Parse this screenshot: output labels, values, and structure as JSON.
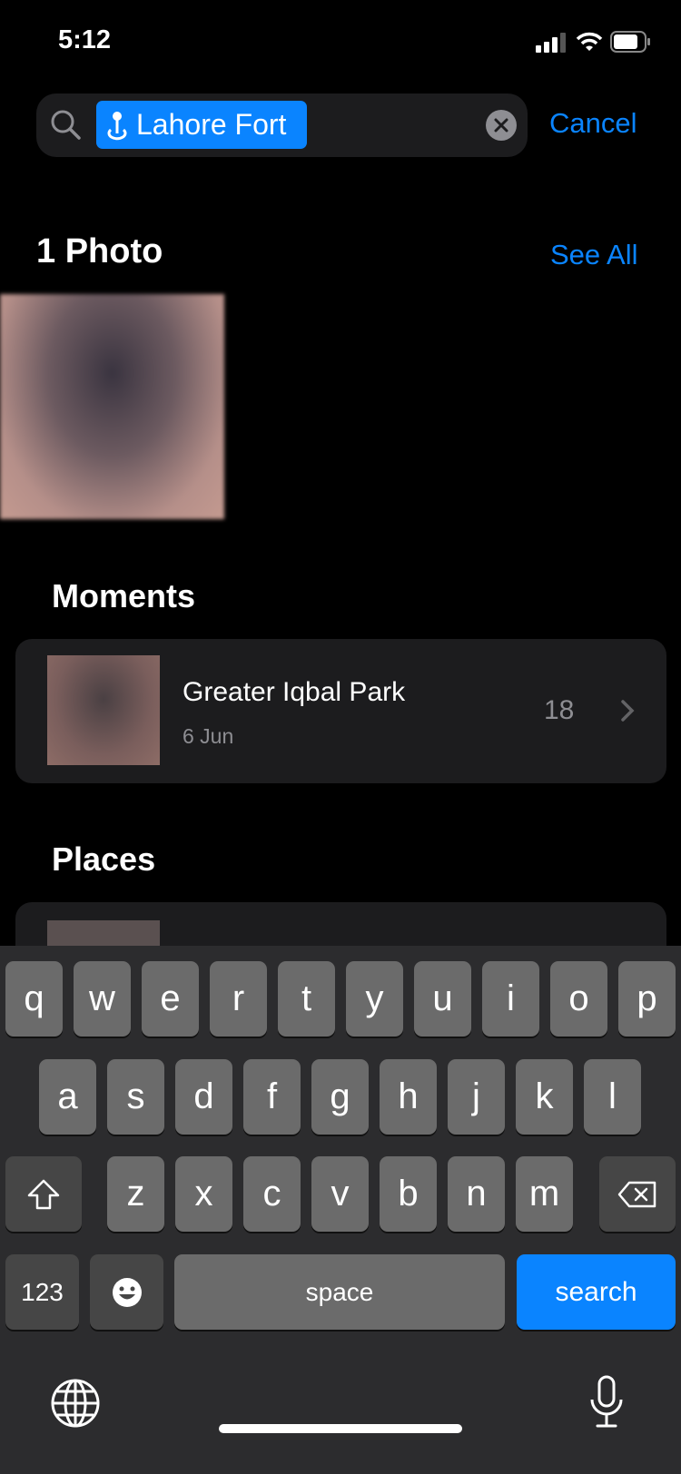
{
  "status_bar": {
    "time": "5:12",
    "icons": [
      "cellular-signal-icon",
      "wifi-icon",
      "battery-icon"
    ]
  },
  "search": {
    "token_icon": "location-pin-icon",
    "token": "Lahore Fort",
    "clear_icon": "clear-icon",
    "cancel": "Cancel"
  },
  "photos": {
    "title": "1 Photo",
    "see_all": "See All"
  },
  "moments": {
    "title": "Moments",
    "items": [
      {
        "title": "Greater Iqbal Park",
        "date": "6 Jun",
        "count": "18"
      }
    ]
  },
  "places": {
    "title": "Places"
  },
  "keyboard": {
    "row1": [
      "q",
      "w",
      "e",
      "r",
      "t",
      "y",
      "u",
      "i",
      "o",
      "p"
    ],
    "row2": [
      "a",
      "s",
      "d",
      "f",
      "g",
      "h",
      "j",
      "k",
      "l"
    ],
    "row3": [
      "z",
      "x",
      "c",
      "v",
      "b",
      "n",
      "m"
    ],
    "numbers": "123",
    "space": "space",
    "search": "search",
    "icons": [
      "shift-icon",
      "delete-icon",
      "emoji-icon",
      "globe-icon",
      "microphone-icon"
    ]
  },
  "colors": {
    "accent": "#0a84ff",
    "card": "#1c1c1e",
    "key": "#6b6b6b"
  }
}
